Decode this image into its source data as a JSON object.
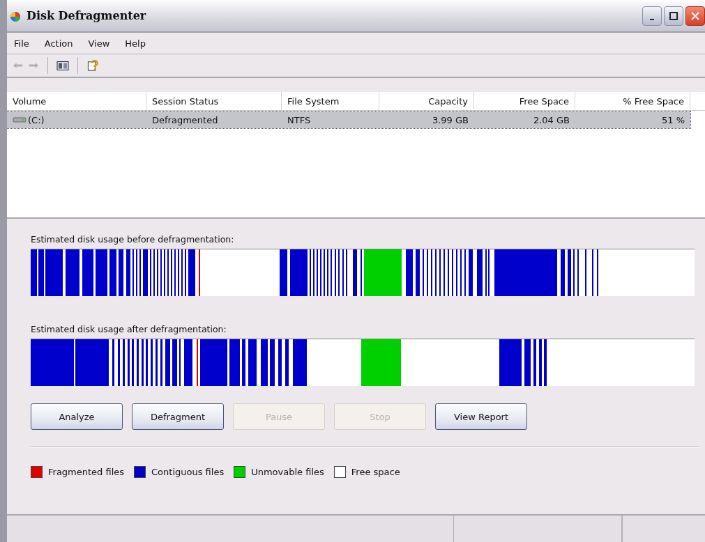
{
  "window": {
    "title": "Disk Defragmenter"
  },
  "menu": [
    "File",
    "Action",
    "View",
    "Help"
  ],
  "volumes": {
    "columns": [
      "Volume",
      "Session Status",
      "File System",
      "Capacity",
      "Free Space",
      "% Free Space"
    ],
    "rows": [
      {
        "selected": true,
        "cells": [
          "(C:)",
          "Defragmented",
          "NTFS",
          "3.99 GB",
          "2.04 GB",
          "51 %"
        ]
      }
    ]
  },
  "before": {
    "label": "Estimated disk usage before defragmentation:"
  },
  "after": {
    "label": "Estimated disk usage after defragmentation:"
  },
  "buttons": [
    {
      "label": "Analyze",
      "disabled": false
    },
    {
      "label": "Defragment",
      "disabled": false
    },
    {
      "label": "Pause",
      "disabled": true
    },
    {
      "label": "Stop",
      "disabled": true
    },
    {
      "label": "View Report",
      "disabled": false
    }
  ],
  "legend": [
    {
      "label": "Fragmented files",
      "color": "#e00000"
    },
    {
      "label": "Contiguous files",
      "color": "#0000cc"
    },
    {
      "label": "Unmovable files",
      "color": "#00d000"
    },
    {
      "label": "Free space",
      "color": "#ffffff"
    }
  ]
}
